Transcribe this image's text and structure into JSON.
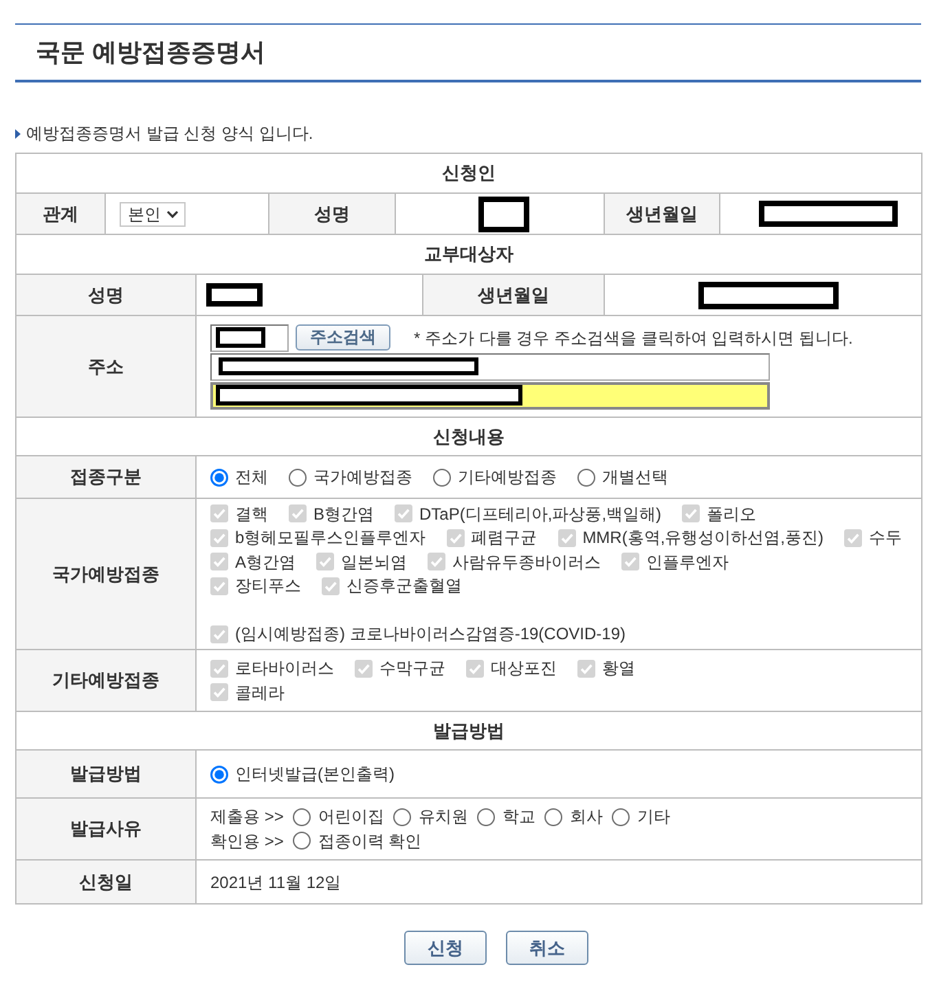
{
  "page_title": "국문 예방접종증명서",
  "intro": "예방접종증명서 발급 신청 양식 입니다.",
  "applicant": {
    "heading": "신청인",
    "relation": {
      "label": "관계",
      "value": "본인"
    },
    "name": {
      "label": "성명",
      "redacted": true
    },
    "birth_date": {
      "label": "생년월일",
      "redacted": true
    }
  },
  "recipient": {
    "heading": "교부대상자",
    "name": {
      "label": "성명",
      "redacted": true
    },
    "birth_date": {
      "label": "생년월일",
      "redacted": true
    },
    "address": {
      "label": "주소",
      "zip_code": {
        "redacted": true
      },
      "search_button": "주소검색",
      "note": "* 주소가 다를 경우 주소검색을 클릭하여 입력하시면 됩니다.",
      "fields": [
        {
          "redacted": true,
          "highlighted": false
        },
        {
          "redacted": true,
          "highlighted": true
        }
      ]
    }
  },
  "request": {
    "heading": "신청내용",
    "vaccination_type": {
      "label": "접종구분",
      "options": [
        {
          "label": "전체",
          "selected": true
        },
        {
          "label": "국가예방접종",
          "selected": false
        },
        {
          "label": "기타예방접종",
          "selected": false
        },
        {
          "label": "개별선택",
          "selected": false
        }
      ]
    },
    "national": {
      "label": "국가예방접종",
      "lines": [
        [
          {
            "label": "결핵",
            "checked": true,
            "disabled": true
          },
          {
            "label": "B형간염",
            "checked": true,
            "disabled": true
          },
          {
            "label": "DTaP(디프테리아,파상풍,백일해)",
            "checked": true,
            "disabled": true
          },
          {
            "label": "폴리오",
            "checked": true,
            "disabled": true
          }
        ],
        [
          {
            "label": "b형헤모필루스인플루엔자",
            "checked": true,
            "disabled": true
          },
          {
            "label": "폐렴구균",
            "checked": true,
            "disabled": true
          },
          {
            "label": "MMR(홍역,유행성이하선염,풍진)",
            "checked": true,
            "disabled": true
          },
          {
            "label": "수두",
            "checked": true,
            "disabled": true
          }
        ],
        [
          {
            "label": "A형간염",
            "checked": true,
            "disabled": true
          },
          {
            "label": "일본뇌염",
            "checked": true,
            "disabled": true
          },
          {
            "label": "사람유두종바이러스",
            "checked": true,
            "disabled": true
          },
          {
            "label": "인플루엔자",
            "checked": true,
            "disabled": true
          }
        ],
        [
          {
            "label": "장티푸스",
            "checked": true,
            "disabled": true
          },
          {
            "label": "신증후군출혈열",
            "checked": true,
            "disabled": true
          }
        ]
      ],
      "temporary": [
        {
          "label": "(임시예방접종) 코로나바이러스감염증-19(COVID-19)",
          "checked": true,
          "disabled": true
        }
      ]
    },
    "other": {
      "label": "기타예방접종",
      "lines": [
        [
          {
            "label": "로타바이러스",
            "checked": true,
            "disabled": true
          },
          {
            "label": "수막구균",
            "checked": true,
            "disabled": true
          },
          {
            "label": "대상포진",
            "checked": true,
            "disabled": true
          },
          {
            "label": "황열",
            "checked": true,
            "disabled": true
          }
        ],
        [
          {
            "label": "콜레라",
            "checked": true,
            "disabled": true
          }
        ]
      ]
    }
  },
  "issuance": {
    "heading": "발급방법",
    "method": {
      "label": "발급방법",
      "options": [
        {
          "label": "인터넷발급(본인출력)",
          "selected": true
        }
      ]
    },
    "reason": {
      "label": "발급사유",
      "groups": [
        {
          "label": "제출용 >>",
          "options": [
            {
              "label": "어린이집",
              "selected": false
            },
            {
              "label": "유치원",
              "selected": false
            },
            {
              "label": "학교",
              "selected": false
            },
            {
              "label": "회사",
              "selected": false
            },
            {
              "label": "기타",
              "selected": false
            }
          ]
        },
        {
          "label": "확인용 >>",
          "options": [
            {
              "label": "접종이력 확인",
              "selected": false
            }
          ]
        }
      ]
    },
    "application_date": {
      "label": "신청일",
      "value": "2021년 11월 12일"
    }
  },
  "buttons": [
    "신청",
    "취소"
  ]
}
